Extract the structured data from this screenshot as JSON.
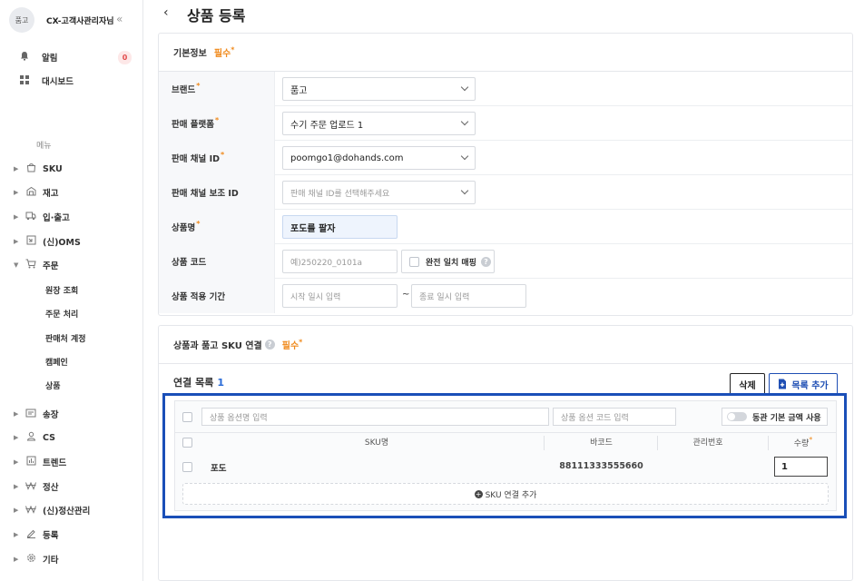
{
  "sidebar": {
    "avatar": "품고",
    "org_name": "CX-고객사관리자님",
    "collapse": "«",
    "alert_label": "알림",
    "alert_count": "0",
    "dashboard_label": "대시보드",
    "menu_label": "메뉴",
    "items": [
      {
        "label": "SKU"
      },
      {
        "label": "재고"
      },
      {
        "label": "입·출고"
      },
      {
        "label": "(신)OMS"
      },
      {
        "label": "주문"
      },
      {
        "label": "송장"
      },
      {
        "label": "CS"
      },
      {
        "label": "트렌드"
      },
      {
        "label": "정산"
      },
      {
        "label": "(신)정산관리"
      },
      {
        "label": "등록"
      },
      {
        "label": "기타"
      }
    ],
    "order_sub": [
      "원장 조회",
      "주문 처리",
      "판매처 계정",
      "캠페인",
      "상품"
    ]
  },
  "header": {
    "back": "‹",
    "title": "상품 등록"
  },
  "basic": {
    "title": "기본정보",
    "required": "필수",
    "brand_label": "브랜드",
    "brand_value": "품고",
    "platform_label": "판매 플랫폼",
    "platform_value": "수기 주문 업로드 1",
    "channel_label": "판매 채널 ID",
    "channel_value": "poomgo1@dohands.com",
    "sub_channel_label": "판매 채널 보조 ID",
    "sub_channel_placeholder": "판매 채널 ID를 선택해주세요",
    "product_name_label": "상품명",
    "product_name_value": "포도를 팔자",
    "product_code_label": "상품 코드",
    "product_code_placeholder": "예)250220_0101a",
    "exact_match_label": "완전 일치 매핑",
    "period_label": "상품 적용 기간",
    "start_placeholder": "시작 일시 입력",
    "dash": "~",
    "end_placeholder": "종료 일시 입력"
  },
  "sku_link": {
    "title": "상품과 품고 SKU 연결",
    "required": "필수",
    "list_title": "연결 목록",
    "list_count": "1",
    "delete_label": "삭제",
    "add_list_label": "목록 추가",
    "option_name_placeholder": "상품 옵션명 입력",
    "option_code_placeholder": "상품 옵션 코드 입력",
    "same_price_label": "동관 기본 금액 사용",
    "columns": [
      "SKU명",
      "바코드",
      "관리번호",
      "수량"
    ],
    "rows": [
      {
        "sku_name": "포도",
        "barcode": "88111333555660",
        "mgmt_no": "",
        "qty": "1"
      }
    ],
    "add_sku_label": "SKU 연결 추가"
  },
  "colors": {
    "accent": "#1a4fb8",
    "required": "#f08a1c",
    "count": "#2a6bd7"
  }
}
